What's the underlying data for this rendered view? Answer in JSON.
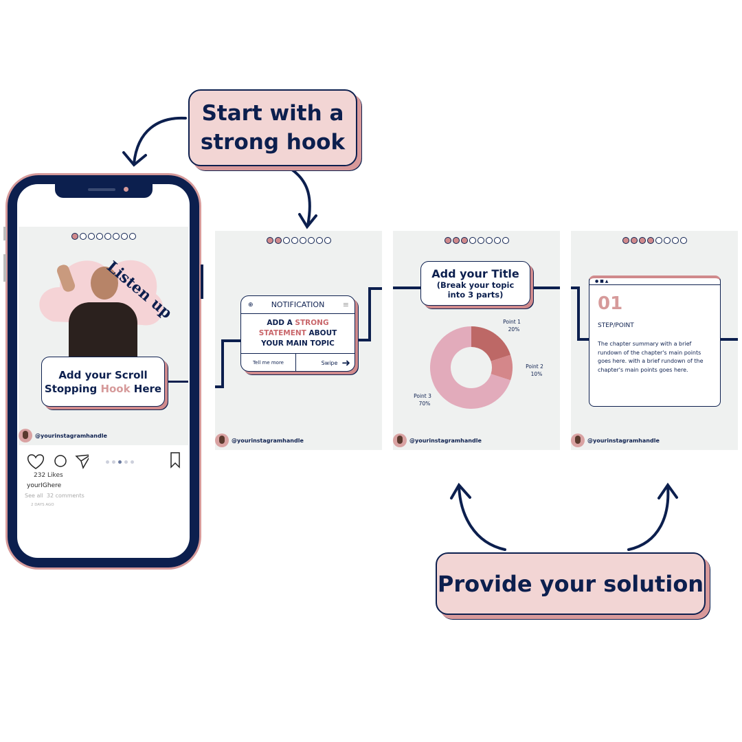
{
  "callouts": {
    "hook": {
      "line1": "Start with a",
      "line2": "strong hook"
    },
    "solution": "Provide your solution"
  },
  "phone": {
    "post": {
      "sticker": "Listen up",
      "hook_line1": "Add your Scroll",
      "hook_line2_a": "Stopping ",
      "hook_line2_b": "Hook",
      "hook_line2_c": " Here",
      "handle": "@yourinstagramhandle",
      "active_dot": 1,
      "dot_count": 8
    },
    "actions": {
      "likes": "232 Likes",
      "username": "yourIGhere",
      "comments": "See all  32 comments",
      "time": "2 DAYS AGO",
      "carousel_active": 3,
      "carousel_count": 5
    }
  },
  "panels": [
    {
      "active_dots": 2,
      "handle": "@yourinstagramhandle",
      "notification": {
        "title": "NOTIFICATION",
        "line1_a": "ADD A ",
        "line1_b": "STRONG",
        "line2_a": "STATEMENT",
        "line2_b": " ABOUT",
        "line3": "YOUR MAIN TOPIC",
        "left_button": "Tell me more",
        "right_button": "Swipe"
      }
    },
    {
      "active_dots": 3,
      "handle": "@yourinstagramhandle",
      "title": "Add your Title",
      "subtitle1": "(Break your topic",
      "subtitle2": "into 3 parts)"
    },
    {
      "active_dots": 4,
      "handle": "@yourinstagramhandle",
      "number": "01",
      "heading": "STEP/POINT",
      "body": "The chapter summary with a brief rundown of the chapter's main points goes here. with a brief rundown of the chapter's main points goes here."
    }
  ],
  "chart_data": {
    "type": "pie",
    "donut": true,
    "categories": [
      "Point 1",
      "Point 2",
      "Point 3"
    ],
    "values": [
      20,
      10,
      70
    ],
    "labels": [
      "20%",
      "10%",
      "70%"
    ],
    "colors": [
      "#bd6866",
      "#d4878a",
      "#e2abbb"
    ]
  },
  "colors": {
    "navy": "#0c1f4e",
    "pink": "#f2d5d4",
    "rose": "#d08a8c",
    "panel_bg": "#eff1f0"
  }
}
